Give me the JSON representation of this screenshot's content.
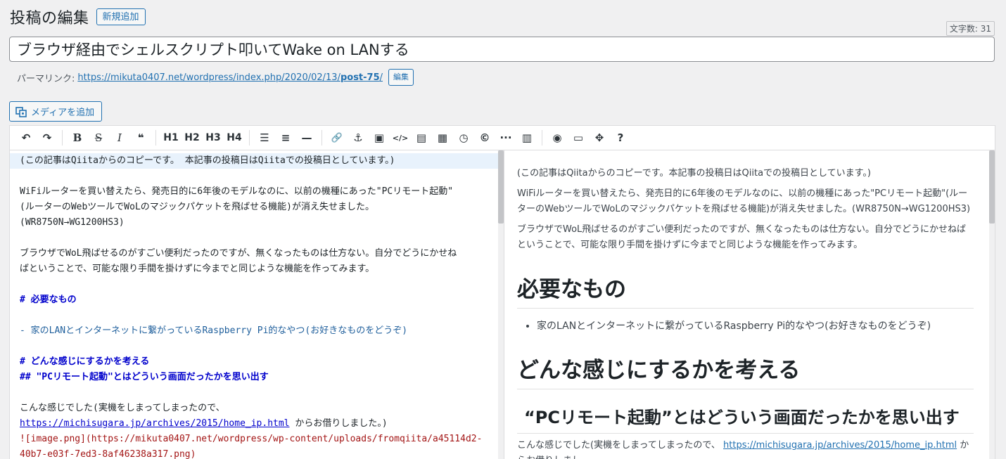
{
  "header": {
    "title": "投稿の編集",
    "add_new_label": "新規追加",
    "word_count": "文字数: 31"
  },
  "post": {
    "title": "ブラウザ経由でシェルスクリプト叩いてWake on LANする"
  },
  "permalink": {
    "label": "パーマリンク:",
    "url_prefix": "https://mikuta0407.net/wordpress/index.php/2020/02/13/",
    "slug": "post-75",
    "url_suffix": "/",
    "edit_label": "編集"
  },
  "media": {
    "add_media_label": "メディアを追加"
  },
  "toolbar": {
    "undo": "↶",
    "redo": "↷",
    "bold": "B",
    "strike": "S",
    "italic": "I",
    "quote": "❝",
    "h1": "H1",
    "h2": "H2",
    "h3": "H3",
    "h4": "H4",
    "ul": "☰",
    "ol": "≡",
    "hr": "—",
    "link": "🔗",
    "anchor": "⚓",
    "image": "▣",
    "code": "</>",
    "file": "▤",
    "table": "▦",
    "clock": "◷",
    "copyright": "©",
    "more": "···",
    "card": "▥",
    "preview": "◉",
    "desktop": "▭",
    "fullscreen": "✥",
    "help": "?"
  },
  "editor": {
    "lines": [
      "(この記事はQiitaからのコピーです。 本記事の投稿日はQiitaでの投稿日としています。)",
      "",
      "WiFiルーターを買い替えたら、発売日的に6年後のモデルなのに、以前の機種にあった\"PCリモート起動\"",
      "(ルーターのWebツールでWoLのマジックパケットを飛ばせる機能)が消え失せました。",
      "(WR8750N→WG1200HS3)",
      "",
      "ブラウザでWoL飛ばせるのがすごい便利だったのですが、無くなったものは仕方ない。自分でどうにかせね",
      "ばということで、可能な限り手間を掛けずに今までと同じような機能を作ってみます。",
      "",
      "# 必要なもの",
      "",
      "- 家のLANとインターネットに繋がっているRaspberry Pi的なやつ(お好きなものをどうぞ)",
      "",
      "# どんな感じにするかを考える",
      "## \"PCリモート起動\"とはどういう画面だったかを思い出す",
      "",
      "こんな感じでした(実機をしまってしまったので、",
      "https://michisugara.jp/archives/2015/home_ip.html",
      " からお借りしました。)",
      "![image.png](https://mikuta0407.net/wordpress/wp-content/uploads/fromqiita/a45114d2-",
      "40b7-e03f-7ed3-8af46238a317.png)"
    ]
  },
  "preview": {
    "p1": "(この記事はQiitaからのコピーです。本記事の投稿日はQiitaでの投稿日としています。)",
    "p2": "WiFiルーターを買い替えたら、発売日的に6年後のモデルなのに、以前の機種にあった\"PCリモート起動\"(ルーターのWebツールでWoLのマジックパケットを飛ばせる機能)が消え失せました。(WR8750N→WG1200HS3)",
    "p3": "ブラウザでWoL飛ばせるのがすごい便利だったのですが、無くなったものは仕方ない。自分でどうにかせねばということで、可能な限り手間を掛けずに今までと同じような機能を作ってみます。",
    "h1a": "必要なもの",
    "li1": "家のLANとインターネットに繋がっているRaspberry Pi的なやつ(お好きなものをどうぞ)",
    "h1b": "どんな感じにするかを考える",
    "h2a": "“PCリモート起動”とはどういう画面だったかを思い出す",
    "p4_text": "こんな感じでした(実機をしまってしまったので、",
    "p4_link": "https://michisugara.jp/archives/2015/home_ip.html",
    "p4_tail": " からお借りしまし"
  }
}
